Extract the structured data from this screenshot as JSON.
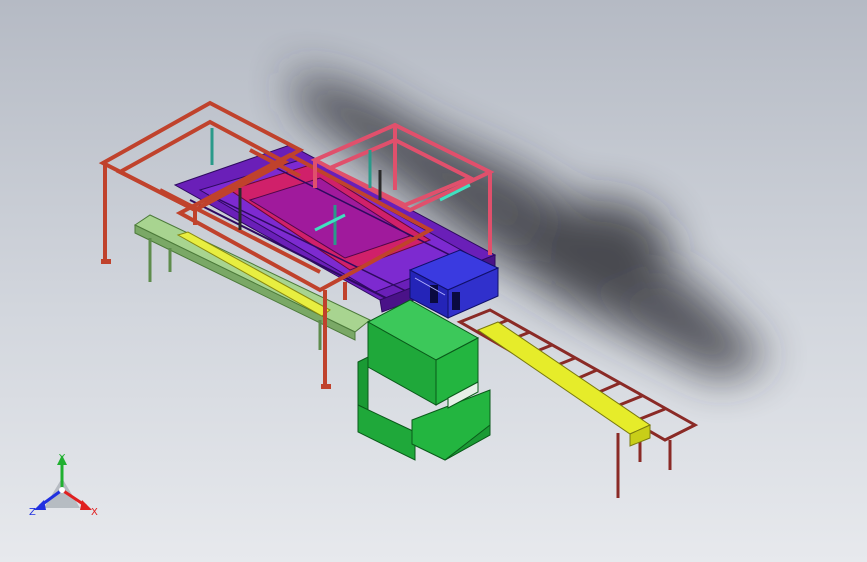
{
  "viewport": {
    "background_top": "#b5bac4",
    "background_bottom": "#e7e9ed",
    "model": {
      "frame_color": "#c0422c",
      "upper_frame_color": "#e0506c",
      "beam_color": "#6a1fb8",
      "beam_accent_color": "#d0206a",
      "table_color": "#8fbf78",
      "machine_color": "#1fa83a",
      "conveyor_color": "#8a2a26",
      "stock_color": "#e6ec2a",
      "fixture_color": "#2a2ad0"
    }
  },
  "triad": {
    "x_label": "X",
    "y_label": "Y",
    "z_label": "Z",
    "x_color": "#e02020",
    "y_color": "#20b030",
    "z_color": "#2030e0"
  }
}
